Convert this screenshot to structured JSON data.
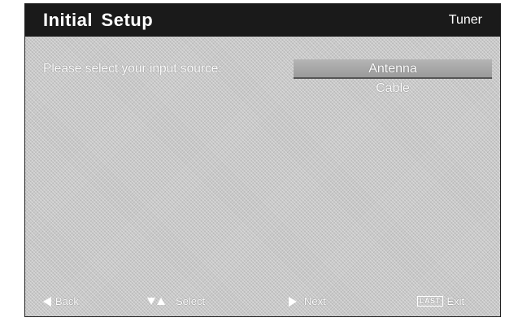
{
  "header": {
    "title": "Initial Setup",
    "section": "Tuner"
  },
  "prompt": "Please select your input source:",
  "options": [
    {
      "label": "Antenna",
      "selected": true
    },
    {
      "label": "Cable",
      "selected": false
    }
  ],
  "footer": {
    "back_label": "Back",
    "select_label": "Select",
    "next_label": "Next",
    "last_key_label": "LAST",
    "exit_label": "Exit"
  },
  "icons": {
    "back": "triangle-left-icon",
    "select": "up-down-icon",
    "next": "triangle-right-icon",
    "exit": "last-key-icon"
  }
}
